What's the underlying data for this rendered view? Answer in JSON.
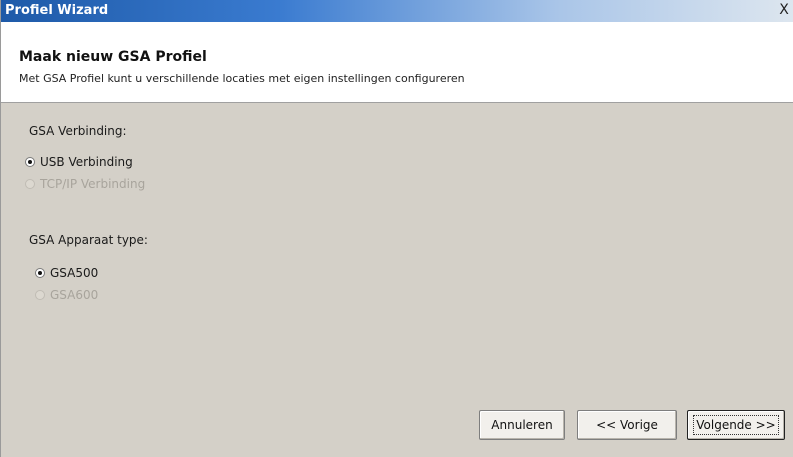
{
  "window": {
    "title": "Profiel Wizard",
    "close_label": "X"
  },
  "header": {
    "title": "Maak nieuw GSA Profiel",
    "subtitle": "Met GSA Profiel kunt u verschillende locaties met eigen instellingen configureren"
  },
  "connection": {
    "label": "GSA Verbinding:",
    "options": [
      {
        "label": "USB Verbinding",
        "checked": true,
        "enabled": true
      },
      {
        "label": "TCP/IP Verbinding",
        "checked": false,
        "enabled": false
      }
    ]
  },
  "device": {
    "label": "GSA Apparaat type:",
    "options": [
      {
        "label": "GSA500",
        "checked": true,
        "enabled": true
      },
      {
        "label": "GSA600",
        "checked": false,
        "enabled": false
      }
    ]
  },
  "buttons": {
    "cancel": "Annuleren",
    "previous": "<< Vorige",
    "next": "Volgende >>"
  }
}
